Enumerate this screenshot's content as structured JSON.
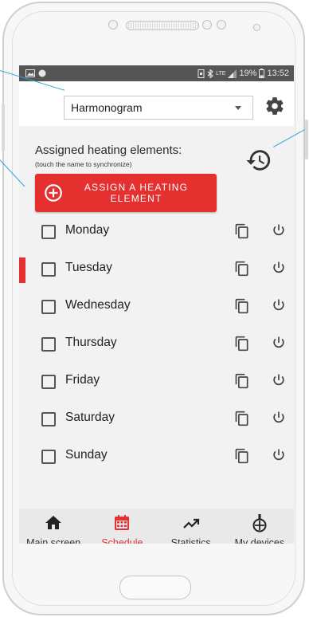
{
  "status_bar": {
    "battery": "19%",
    "time": "13:52",
    "network": "LTE"
  },
  "app_bar": {
    "dropdown_value": "Harmonogram"
  },
  "heating": {
    "assigned_title": "Assigned heating elements:",
    "assigned_hint": "(touch the name to synchronize)",
    "assign_button_line1": "ASSIGN A HEATING",
    "assign_button_line2": "ELEMENT"
  },
  "days": [
    {
      "name": "Monday",
      "checked": false,
      "selected": false
    },
    {
      "name": "Tuesday",
      "checked": false,
      "selected": true
    },
    {
      "name": "Wednesday",
      "checked": false,
      "selected": false
    },
    {
      "name": "Thursday",
      "checked": false,
      "selected": false
    },
    {
      "name": "Friday",
      "checked": false,
      "selected": false
    },
    {
      "name": "Saturday",
      "checked": false,
      "selected": false
    },
    {
      "name": "Sunday",
      "checked": false,
      "selected": false
    }
  ],
  "bottom_nav": [
    {
      "label": "Main screen",
      "icon": "home-icon",
      "active": false
    },
    {
      "label": "Schedule",
      "icon": "calendar-icon",
      "active": true
    },
    {
      "label": "Statistics",
      "icon": "trend-icon",
      "active": false
    },
    {
      "label": "My devices",
      "icon": "device-icon",
      "active": false
    }
  ],
  "colors": {
    "accent": "#e53030",
    "status_bar": "#555555",
    "callout": "#2aa7d6",
    "nav_bg": "#e9e9e9"
  }
}
